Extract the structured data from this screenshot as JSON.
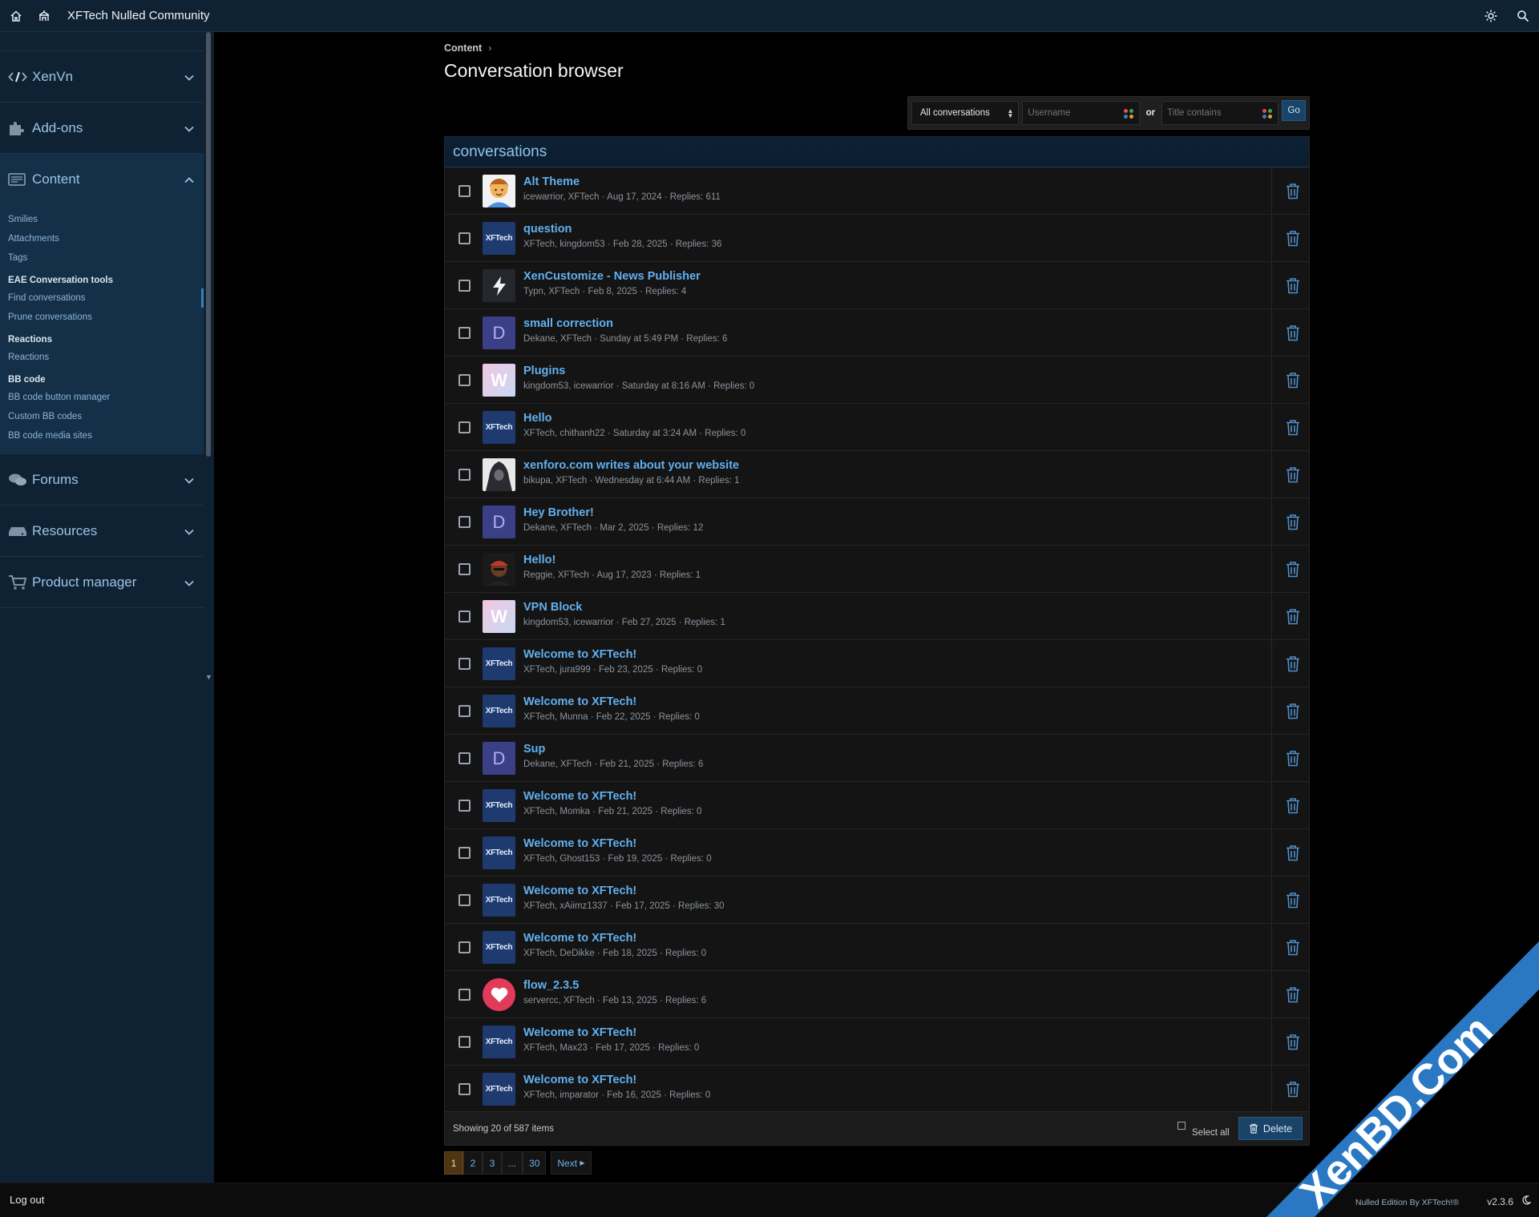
{
  "topbar": {
    "title": "XFTech Nulled Community"
  },
  "sidebar": {
    "sections_top": [
      {
        "label": "XenVn",
        "icon": "code-icon"
      },
      {
        "label": "Add-ons",
        "icon": "puzzle-icon"
      }
    ],
    "content": {
      "label": "Content",
      "groups": [
        {
          "title": "",
          "items": [
            "Smilies",
            "Attachments",
            "Tags"
          ]
        },
        {
          "title": "EAE Conversation tools",
          "items": [
            "Find conversations",
            "Prune conversations"
          ]
        },
        {
          "title": "Reactions",
          "items": [
            "Reactions"
          ]
        },
        {
          "title": "BB code",
          "items": [
            "BB code button manager",
            "Custom BB codes",
            "BB code media sites"
          ]
        }
      ]
    },
    "sections_bottom": [
      {
        "label": "Forums",
        "icon": "chat-icon"
      },
      {
        "label": "Resources",
        "icon": "server-icon"
      },
      {
        "label": "Product manager",
        "icon": "cart-icon"
      }
    ],
    "logout": "Log out"
  },
  "breadcrumb": {
    "label": "Content",
    "sep": "›"
  },
  "page_title": "Conversation browser",
  "filter": {
    "select_value": "All conversations",
    "username_placeholder": "Username",
    "or_label": "or",
    "title_placeholder": "Title contains",
    "go_label": "Go"
  },
  "block_title": "conversations",
  "conversations": [
    {
      "title": "Alt Theme",
      "meta": "icewarrior, XFTech · Aug 17, 2024 · Replies: 611",
      "avatar": "face"
    },
    {
      "title": "question",
      "meta": "XFTech, kingdom53 · Feb 28, 2025 · Replies: 36",
      "avatar": "xftech"
    },
    {
      "title": "XenCustomize - News Publisher",
      "meta": "Typn, XFTech · Feb 8, 2025 · Replies: 4",
      "avatar": "bolt"
    },
    {
      "title": "small correction",
      "meta": "Dekane, XFTech · Sunday at 5:49 PM · Replies: 6",
      "avatar": "D"
    },
    {
      "title": "Plugins",
      "meta": "kingdom53, icewarrior · Saturday at 8:16 AM · Replies: 0",
      "avatar": "W"
    },
    {
      "title": "Hello",
      "meta": "XFTech, chithanh22 · Saturday at 3:24 AM · Replies: 0",
      "avatar": "xftech"
    },
    {
      "title": "xenforo.com writes about your website",
      "meta": "bikupa, XFTech · Wednesday at 6:44 AM · Replies: 1",
      "avatar": "hood"
    },
    {
      "title": "Hey Brother!",
      "meta": "Dekane, XFTech · Mar 2, 2025 · Replies: 12",
      "avatar": "D"
    },
    {
      "title": "Hello!",
      "meta": "Reggie, XFTech · Aug 17, 2023 · Replies: 1",
      "avatar": "reggie"
    },
    {
      "title": "VPN Block",
      "meta": "kingdom53, icewarrior · Feb 27, 2025 · Replies: 1",
      "avatar": "W"
    },
    {
      "title": "Welcome to XFTech!",
      "meta": "XFTech, jura999 · Feb 23, 2025 · Replies: 0",
      "avatar": "xftech"
    },
    {
      "title": "Welcome to XFTech!",
      "meta": "XFTech, Munna · Feb 22, 2025 · Replies: 0",
      "avatar": "xftech"
    },
    {
      "title": "Sup",
      "meta": "Dekane, XFTech · Feb 21, 2025 · Replies: 6",
      "avatar": "D"
    },
    {
      "title": "Welcome to XFTech!",
      "meta": "XFTech, Momka · Feb 21, 2025 · Replies: 0",
      "avatar": "xftech"
    },
    {
      "title": "Welcome to XFTech!",
      "meta": "XFTech, Ghost153 · Feb 19, 2025 · Replies: 0",
      "avatar": "xftech"
    },
    {
      "title": "Welcome to XFTech!",
      "meta": "XFTech, xAiimz1337 · Feb 17, 2025 · Replies: 30",
      "avatar": "xftech"
    },
    {
      "title": "Welcome to XFTech!",
      "meta": "XFTech, DeDikke · Feb 18, 2025 · Replies: 0",
      "avatar": "xftech"
    },
    {
      "title": "flow_2.3.5",
      "meta": "servercc, XFTech · Feb 13, 2025 · Replies: 6",
      "avatar": "heart"
    },
    {
      "title": "Welcome to XFTech!",
      "meta": "XFTech, Max23 · Feb 17, 2025 · Replies: 0",
      "avatar": "xftech"
    },
    {
      "title": "Welcome to XFTech!",
      "meta": "XFTech, imparator · Feb 16, 2025 · Replies: 0",
      "avatar": "xftech"
    }
  ],
  "avatar_texts": {
    "xftech": "XFTech",
    "D": "D",
    "W": "W"
  },
  "footer": {
    "showing": "Showing 20 of 587 items",
    "select_all": "Select all",
    "delete": "Delete"
  },
  "pagination": {
    "pages": [
      "1",
      "2",
      "3",
      "...",
      "30"
    ],
    "current": "1",
    "next": "Next"
  },
  "bottom": {
    "edition": "Nulled Edition By XFTech!®",
    "version": "v2.3.6"
  },
  "watermark": "XenBD.Com",
  "colors": {
    "accent": "#62b0f0",
    "sidebar": "#0f2233",
    "button": "#1a4368",
    "current_page": "#4d3514"
  }
}
